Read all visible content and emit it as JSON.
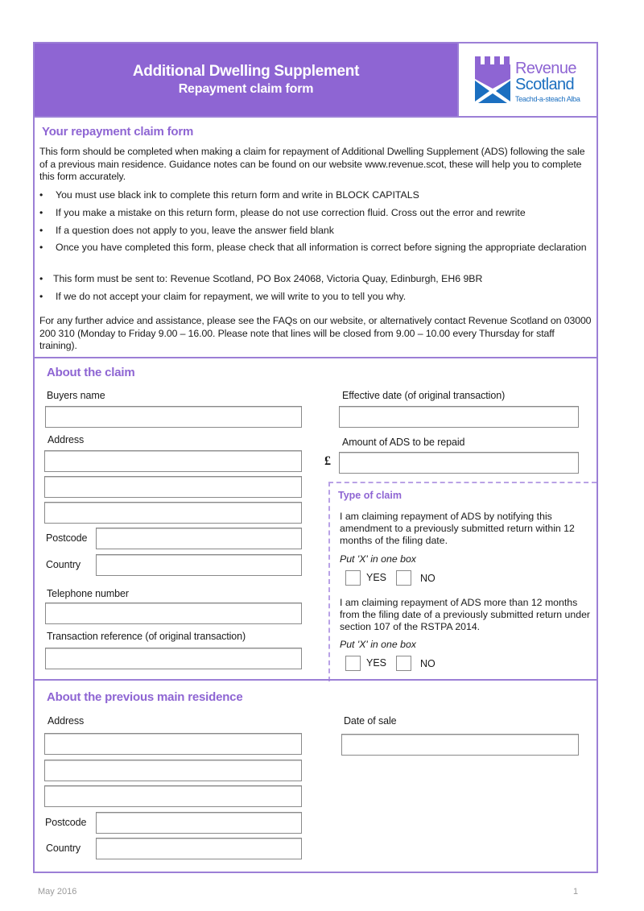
{
  "header": {
    "title": "Additional Dwelling Supplement",
    "subtitle": "Repayment claim form",
    "logo": {
      "icon": "revenue-scotland-tower-saltire-icon",
      "line1": "Revenue",
      "line2": "Scotland",
      "tagline": "Teachd-a-steach Alba",
      "purple": "#8e65d3",
      "blue": "#1b6fc0"
    }
  },
  "intro": {
    "title": "Your repayment claim form",
    "paragraph": "This form should be completed when making a claim for repayment of Additional Dwelling Supplement (ADS) following the sale of a previous main residence.  Guidance notes can be found on our website www.revenue.scot, these will help you to complete this form accurately.",
    "bullets": [
      "You must use black ink to complete this return form and write in BLOCK CAPITALS",
      "If you make a mistake on this return form, please do not use correction fluid.  Cross out the error and rewrite",
      "If a question does not apply to you, leave the answer field blank",
      "Once you have completed this form, please check that all information is correct before signing the appropriate declaration",
      "This form must be sent to: Revenue Scotland, PO Box 24068, Victoria Quay, Edinburgh, EH6 9BR",
      "If we do not accept your claim for repayment, we will write to you to tell you why."
    ],
    "bullet_glyph": "•",
    "contact": "For any further advice and assistance, please see the FAQs on our website, or alternatively contact Revenue Scotland on 03000 200 310 (Monday to Friday 9.00 – 16.00.  Please note that lines will be closed from 9.00 – 10.00 every Thursday for staff training)."
  },
  "about_claim": {
    "title": "About the claim",
    "buyers_name_label": "Buyers name",
    "buyers_name_value": "",
    "address_label": "Address",
    "address_values": [
      "",
      "",
      ""
    ],
    "postcode_label": "Postcode",
    "postcode_value": "",
    "country_label": "Country",
    "country_value": "",
    "telephone_label": "Telephone number",
    "telephone_value": "",
    "transaction_ref_label": "Transaction reference (of original transaction)",
    "transaction_ref_value": "",
    "effective_date_label": "Effective date (of original transaction)",
    "effective_date_value": "",
    "amount_label": "Amount of ADS to be repaid",
    "amount_currency": "£",
    "amount_value": ""
  },
  "type_of_claim": {
    "title": "Type of claim",
    "q1": "I am claiming repayment of ADS by notifying this amendment to a previously submitted return within 12 months of the filing date.",
    "q2": "I am claiming repayment of ADS more than 12 months from the filing date of a previously submitted return under section 107 of the RSTPA 2014.",
    "hint": "Put 'X' in one box",
    "yes_label": "YES",
    "no_label": "NO"
  },
  "previous_residence": {
    "title": "About the previous main residence",
    "address_label": "Address",
    "address_values": [
      "",
      "",
      ""
    ],
    "postcode_label": "Postcode",
    "postcode_value": "",
    "country_label": "Country",
    "country_value": "",
    "date_of_sale_label": "Date of sale",
    "date_of_sale_value": ""
  },
  "footer": {
    "date": "May 2016",
    "page_number": "1"
  }
}
